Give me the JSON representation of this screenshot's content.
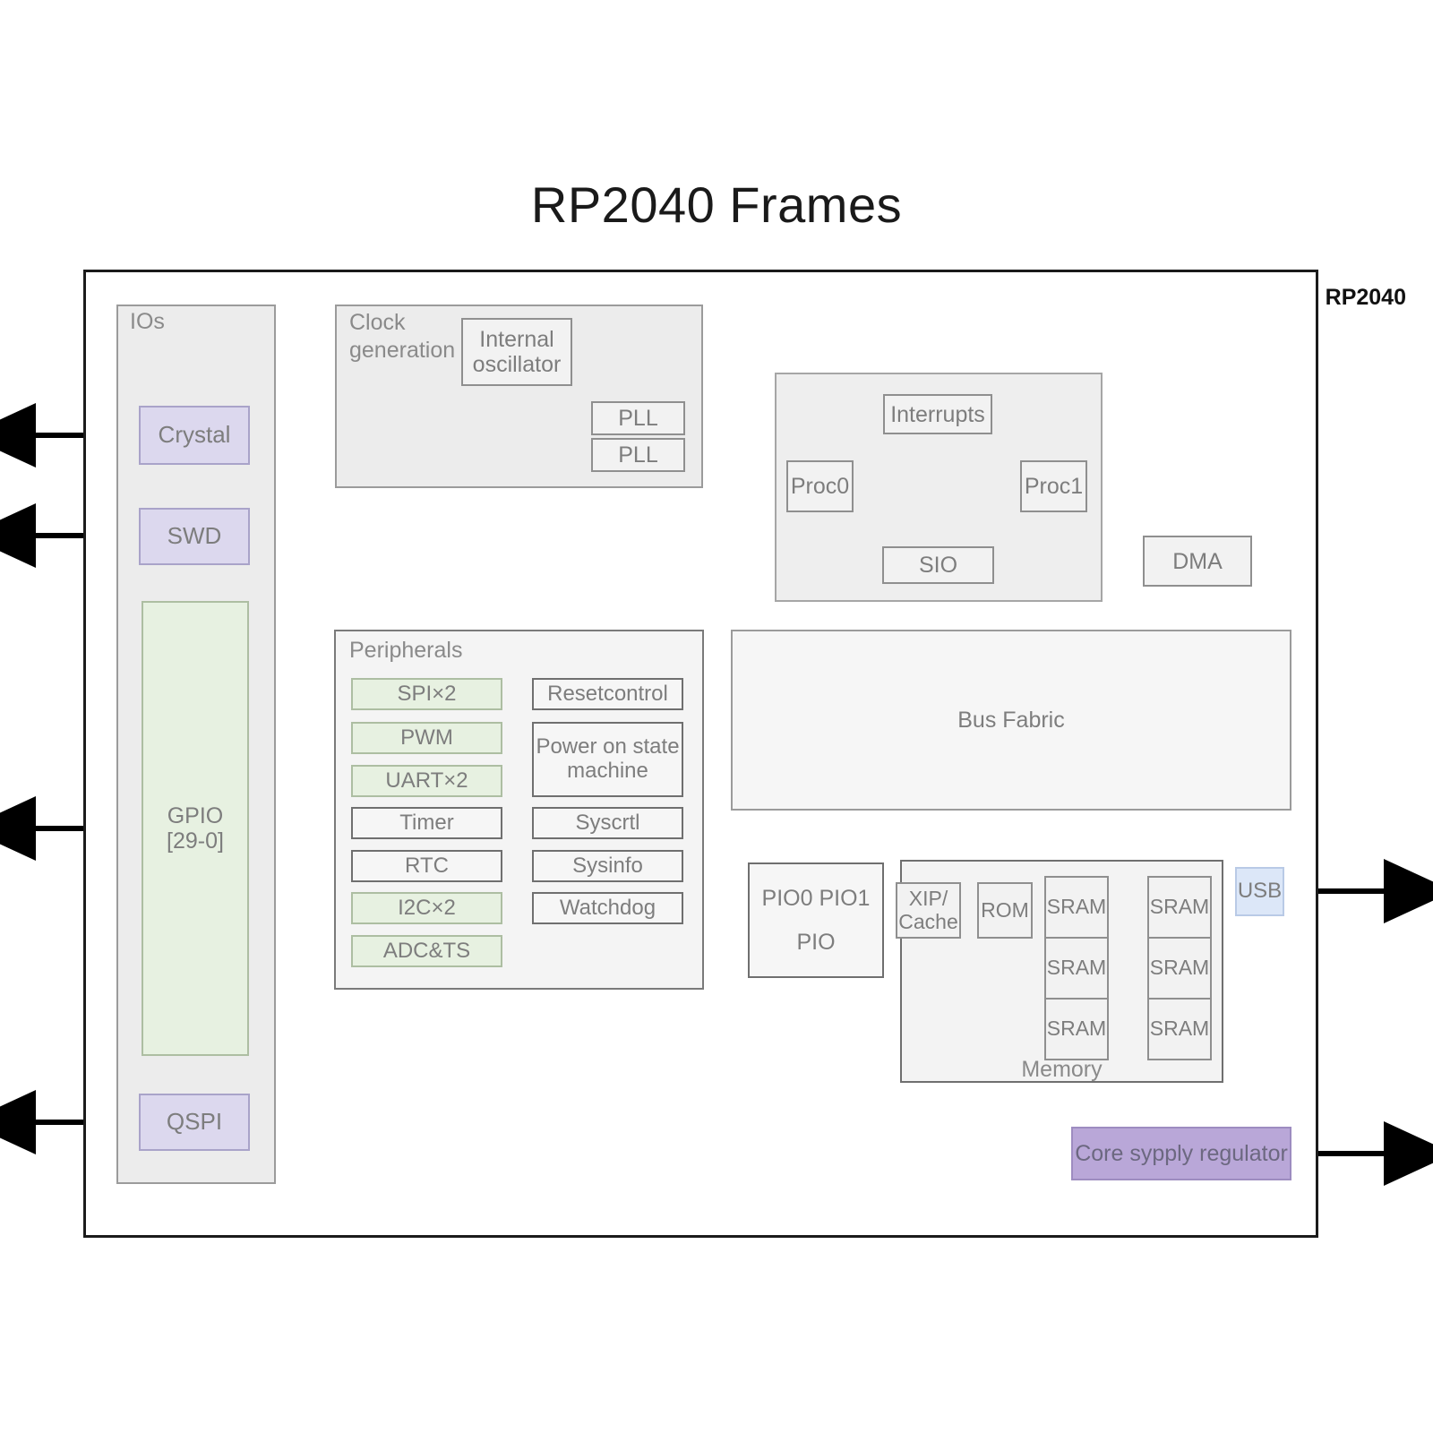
{
  "title": "RP2040 Frames",
  "chip": {
    "label": "RP2040"
  },
  "ios": {
    "label": "IOs",
    "blocks": [
      {
        "label": "Crystal"
      },
      {
        "label": "SWD"
      },
      {
        "label": "GPIO\n[29-0]",
        "line1": "GPIO",
        "line2": "[29-0]"
      },
      {
        "label": "QSPI"
      }
    ]
  },
  "clock": {
    "label_line1": "Clock",
    "label_line2": "generation",
    "internal_oscillator_line1": "Internal",
    "internal_oscillator_line2": "oscillator",
    "pll_top": "PLL",
    "pll_bottom": "PLL"
  },
  "cores": {
    "interrupts": "Interrupts",
    "proc0": "Proc0",
    "proc1": "Proc1",
    "sio": "SIO"
  },
  "dma": {
    "label": "DMA"
  },
  "bus": {
    "label": "Bus Fabric"
  },
  "peripherals": {
    "label": "Peripherals",
    "left_column": [
      {
        "label": "SPI×2",
        "style": "green"
      },
      {
        "label": "PWM",
        "style": "green"
      },
      {
        "label": "UART×2",
        "style": "green"
      },
      {
        "label": "Timer",
        "style": "white"
      },
      {
        "label": "RTC",
        "style": "white"
      },
      {
        "label": "I2C×2",
        "style": "green"
      },
      {
        "label": "ADC&TS",
        "style": "green"
      }
    ],
    "right_column": [
      {
        "label": "Resetcontrol"
      },
      {
        "label": "Power on state machine",
        "line1": "Power on state",
        "line2": "machine"
      },
      {
        "label": "Syscrtl"
      },
      {
        "label": "Sysinfo"
      },
      {
        "label": "Watchdog"
      }
    ]
  },
  "pio": {
    "label_top": "PIO0  PIO1",
    "label_bottom": "PIO"
  },
  "memory": {
    "label": "Memory",
    "xip_line1": "XIP/",
    "xip_line2": "Cache",
    "rom": "ROM",
    "sram_left": [
      "SRAM",
      "SRAM",
      "SRAM"
    ],
    "sram_right": [
      "SRAM",
      "SRAM",
      "SRAM"
    ]
  },
  "usb": {
    "label": "USB"
  },
  "regulator": {
    "label": "Core sypply regulator"
  },
  "colors": {
    "green_fill": "#e7f1e1",
    "purple_fill": "#dcd8ee",
    "purple_solid": "#b9a7d8",
    "blue_fill": "#dce7f8",
    "grey_fill": "#ececec",
    "wire": "#808080",
    "wire_dark": "#3a3a3a",
    "arrow": "#000000"
  }
}
